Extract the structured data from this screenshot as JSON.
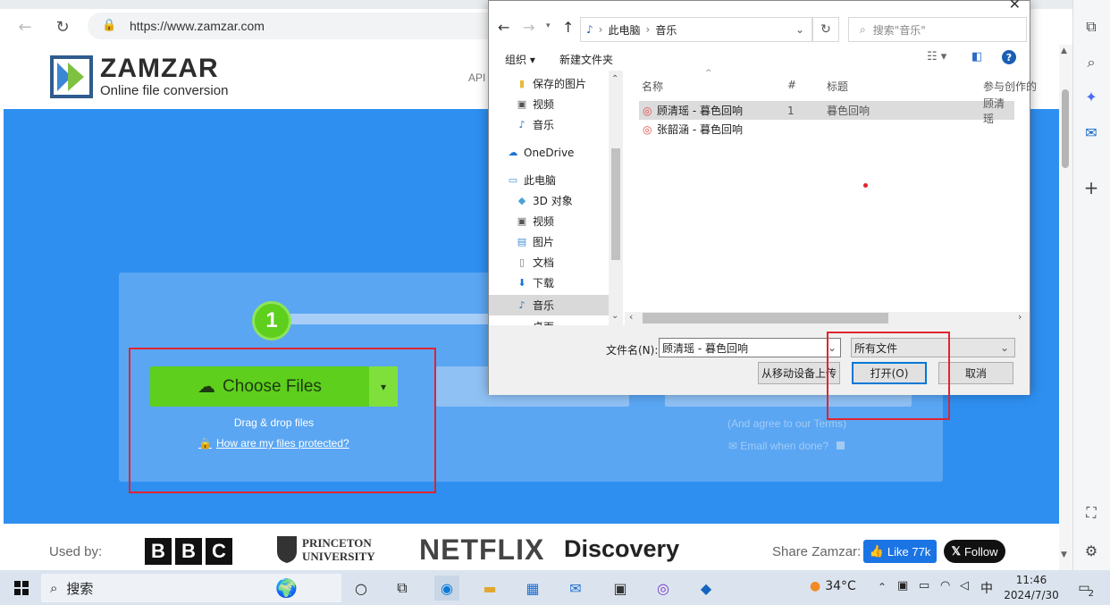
{
  "browser": {
    "url": "https://www.zamzar.com"
  },
  "site": {
    "brand": "ZAMZAR",
    "tagline": "Online file conversion",
    "nav_api": "API",
    "step_number": "1",
    "choose_files": "Choose Files",
    "drag_drop": "Drag & drop files",
    "protected_link": "How are my files protected?",
    "agree_text": "(And agree to our Terms)",
    "email_text": "Email when done?",
    "used_by": "Used by:",
    "share_label": "Share Zamzar:",
    "like_label": "Like 77k",
    "follow_label": "Follow",
    "logos": {
      "bbc": [
        "B",
        "B",
        "C"
      ],
      "princeton_line1": "PRINCETON",
      "princeton_line2": "UNIVERSITY",
      "netflix": "NETFLIX",
      "discovery": "Discovery"
    }
  },
  "dialog": {
    "breadcrumb": [
      "此电脑",
      "音乐"
    ],
    "search_placeholder": "搜索\"音乐\"",
    "toolbar": {
      "organize": "组织 ▾",
      "new_folder": "新建文件夹"
    },
    "nav_items": [
      {
        "label": "保存的图片",
        "icon": "folder-icon"
      },
      {
        "label": "视频",
        "icon": "video-icon"
      },
      {
        "label": "音乐",
        "icon": "music-icon"
      },
      {
        "label": "OneDrive",
        "icon": "cloud-icon"
      },
      {
        "label": "此电脑",
        "icon": "computer-icon"
      },
      {
        "label": "3D 对象",
        "icon": "cube-icon"
      },
      {
        "label": "视频",
        "icon": "video-icon"
      },
      {
        "label": "图片",
        "icon": "picture-icon"
      },
      {
        "label": "文档",
        "icon": "document-icon"
      },
      {
        "label": "下载",
        "icon": "download-icon"
      },
      {
        "label": "音乐",
        "icon": "music-icon"
      },
      {
        "label": "桌面",
        "icon": "desktop-icon"
      }
    ],
    "columns": [
      "名称",
      "#",
      "标题",
      "参与创作的"
    ],
    "files": [
      {
        "name": "顾清瑶 - 暮色回响",
        "track": "1",
        "title": "暮色回响",
        "artist": "顾清瑶",
        "selected": true
      },
      {
        "name": "张韶涵 - 暮色回响",
        "track": "",
        "title": "",
        "artist": "",
        "selected": false
      }
    ],
    "filename_label": "文件名(N):",
    "filename_value": "顾清瑶 - 暮色回响",
    "filetype_value": "所有文件",
    "upload_mobile": "从移动设备上传",
    "open_button": "打开(O)",
    "cancel_button": "取消"
  },
  "taskbar": {
    "search_label": "搜索",
    "weather": "34°C",
    "ime": "中",
    "time": "11:46",
    "date": "2024/7/30",
    "notification_count": "2"
  },
  "colors": {
    "hero_blue": "#2e8ff0",
    "accent_green": "#5dcf1c",
    "highlight_red": "#e0242f"
  }
}
